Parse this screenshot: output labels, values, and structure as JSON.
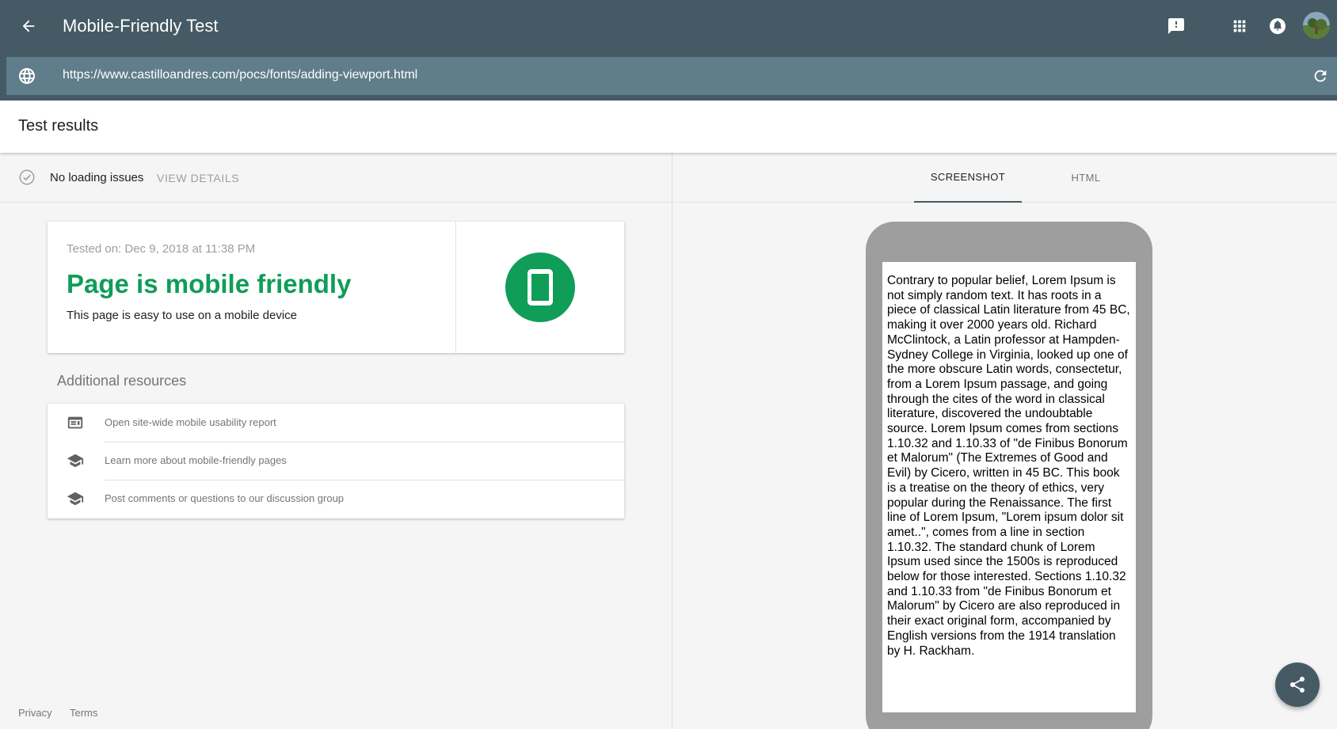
{
  "appbar": {
    "title": "Mobile-Friendly Test",
    "icons": [
      "back-arrow-icon",
      "feedback-icon",
      "apps-grid-icon",
      "notifications-icon",
      "avatar"
    ]
  },
  "url_bar": {
    "url": "https://www.castilloandres.com/pocs/fonts/adding-viewport.html"
  },
  "results": {
    "title": "Test results"
  },
  "status": {
    "text": "No loading issues",
    "view_details": "VIEW DETAILS"
  },
  "result_card": {
    "tested_on": "Tested on: Dec 9, 2018 at 11:38 PM",
    "verdict": "Page is mobile friendly",
    "subtitle": "This page is easy to use on a mobile device",
    "verdict_color": "#0f9d58"
  },
  "resources": {
    "title": "Additional resources",
    "items": [
      {
        "label": "Open site-wide mobile usability report",
        "icon": "report-icon"
      },
      {
        "label": "Learn more about mobile-friendly pages",
        "icon": "school-icon"
      },
      {
        "label": "Post comments or questions to our discussion group",
        "icon": "school-icon"
      }
    ]
  },
  "footer": {
    "privacy": "Privacy",
    "terms": "Terms"
  },
  "tabs": {
    "screenshot": "SCREENSHOT",
    "html": "HTML",
    "active": "SCREENSHOT"
  },
  "preview": {
    "text": "Contrary to popular belief, Lorem Ipsum is not simply random text. It has roots in a piece of classical Latin literature from 45 BC, making it over 2000 years old. Richard McClintock, a Latin professor at Hampden-Sydney College in Virginia, looked up one of the more obscure Latin words, consectetur, from a Lorem Ipsum passage, and going through the cites of the word in classical literature, discovered the undoubtable source. Lorem Ipsum comes from sections 1.10.32 and 1.10.33 of \"de Finibus Bonorum et Malorum\" (The Extremes of Good and Evil) by Cicero, written in 45 BC. This book is a treatise on the theory of ethics, very popular during the Renaissance. The first line of Lorem Ipsum, \"Lorem ipsum dolor sit amet..\", comes from a line in section 1.10.32. The standard chunk of Lorem Ipsum used since the 1500s is reproduced below for those interested. Sections 1.10.32 and 1.10.33 from \"de Finibus Bonorum et Malorum\" by Cicero are also reproduced in their exact original form, accompanied by English versions from the 1914 translation by H. Rackham."
  },
  "colors": {
    "appbar": "#455a64",
    "url_bar": "#607d8b",
    "success": "#0f9d58",
    "fab": "#455a64"
  }
}
